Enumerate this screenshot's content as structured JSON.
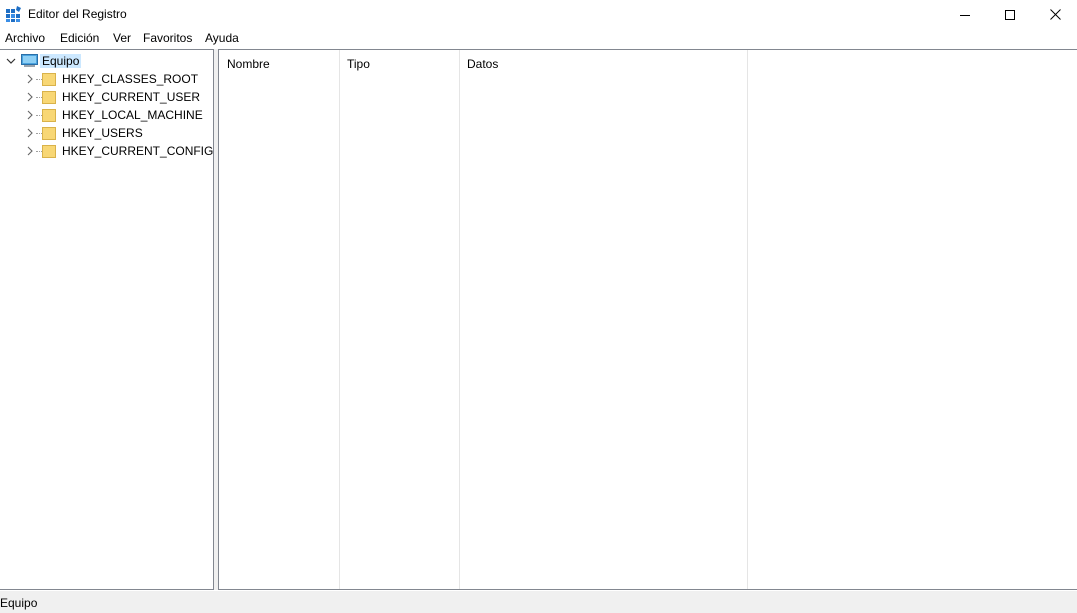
{
  "window": {
    "title": "Editor del Registro",
    "icon": "regedit-icon"
  },
  "menu": [
    "Archivo",
    "Edición",
    "Ver",
    "Favoritos",
    "Ayuda"
  ],
  "tree": {
    "root": {
      "label": "Equipo",
      "icon": "computer-icon",
      "expanded": true,
      "selected": true
    },
    "children": [
      {
        "label": "HKEY_CLASSES_ROOT"
      },
      {
        "label": "HKEY_CURRENT_USER"
      },
      {
        "label": "HKEY_LOCAL_MACHINE"
      },
      {
        "label": "HKEY_USERS"
      },
      {
        "label": "HKEY_CURRENT_CONFIG"
      }
    ]
  },
  "values": {
    "columns": [
      "Nombre",
      "Tipo",
      "Datos"
    ],
    "rows": []
  },
  "status": {
    "path": "Equipo"
  },
  "colors": {
    "selection": "#cce8ff",
    "folder": "#f8d775",
    "border": "#828790",
    "statusbar": "#f0f0f0"
  }
}
